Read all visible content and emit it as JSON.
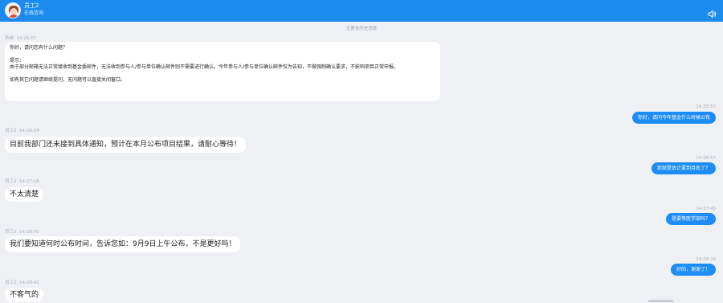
{
  "header": {
    "name": "员工2",
    "status": "在线咨询"
  },
  "history_text": "无更多历史消息",
  "welcome": {
    "sender": "系统",
    "time": "14:25:07",
    "lines": [
      "你好，请问您有什么问题？",
      "",
      "提示：",
      "由于部分邮箱无法正常接收到基金委邮件，无法收到参与人/参与单位确认邮件则不需要进行确认。今年参与人/参与单位确认邮件仅为告知，不做强制确认要求，不影响项目正常申报。",
      "",
      "如有其它问题请继续提问，无问题可以直接关闭窗口。"
    ]
  },
  "messages": [
    {
      "side": "right",
      "time": "14:25:57",
      "text": "你好，请问今年基金什么时候公布"
    },
    {
      "side": "left",
      "sender": "员工2",
      "time": "14:26:24",
      "text": "目前我部门还未接到具体通知，预计在本月公布项目结果，请耐心等待！"
    },
    {
      "side": "right",
      "time": "14:26:57",
      "text": "那就是估计要到月底了？"
    },
    {
      "side": "left",
      "sender": "员工2",
      "time": "14:27:16",
      "text": "不太清楚"
    },
    {
      "side": "right",
      "time": "14:27:45",
      "text": "是要等医学部吗？"
    },
    {
      "side": "left",
      "sender": "员工2",
      "time": "14:28:00",
      "text": "我们要知道何时公布时间，告诉您如：9月9日上午公布，不是更好吗！"
    },
    {
      "side": "right",
      "time": "14:28:26",
      "text": "好的，谢谢了！"
    },
    {
      "side": "left",
      "sender": "员工2",
      "time": "14:28:42",
      "text": "不客气的"
    }
  ],
  "colors": {
    "header": "#1b8bf0",
    "user_bubble": "#1e8cf5",
    "background": "#eef0f4",
    "agent_bubble": "#ffffff"
  },
  "icons": {
    "avatar": "agent-avatar",
    "sound": "speaker-icon"
  }
}
